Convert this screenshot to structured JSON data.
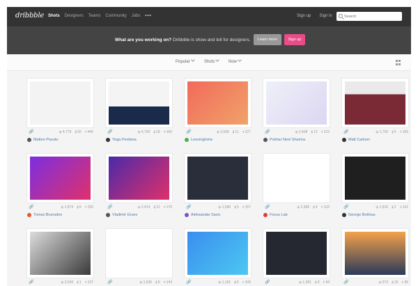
{
  "header": {
    "logo": "dribbble",
    "nav": [
      "Shots",
      "Designers",
      "Teams",
      "Community",
      "Jobs"
    ],
    "more": "•••",
    "signup": "Sign up",
    "signin": "Sign in",
    "search_placeholder": "Search"
  },
  "hero": {
    "question": "What are you working on?",
    "tagline": "Dribbble is show and tell for designers.",
    "learn_more": "Learn more",
    "sign_up": "Sign up"
  },
  "filters": {
    "popular": "Popular",
    "shots": "Shots",
    "now": "Now"
  },
  "colors": {
    "accent": "#ea4c89",
    "topbar": "#333333",
    "hero": "#444444"
  },
  "shots": [
    {
      "views": "4,779",
      "comments": "50",
      "likes": "440",
      "author": "Matteo Pasuto",
      "avatar": "#555555"
    },
    {
      "views": "4,700",
      "comments": "18",
      "likes": "390",
      "author": "Yoga Perdana",
      "avatar": "#333333"
    },
    {
      "views": "3,558",
      "comments": "11",
      "likes": "227",
      "author": "Leevinglome",
      "avatar": "#4caf50"
    },
    {
      "views": "2,408",
      "comments": "13",
      "likes": "215",
      "author": "Pokhar Neel Sharma",
      "avatar": "#555555"
    },
    {
      "views": "1,756",
      "comments": "6",
      "likes": "189",
      "author": "Matt Carlson",
      "avatar": "#333333"
    },
    {
      "views": "1,874",
      "comments": "6",
      "likes": "155",
      "author": "Tomas Brunsdon",
      "avatar": "#e8592a"
    },
    {
      "views": "2,414",
      "comments": "12",
      "likes": "170",
      "author": "Vladimir Gruev",
      "avatar": "#555555"
    },
    {
      "views": "1,586",
      "comments": "5",
      "likes": "157",
      "author": "Aleksandar Savic",
      "avatar": "#7b52c7"
    },
    {
      "views": "2,989",
      "comments": "4",
      "likes": "132",
      "author": "Focus Lab",
      "avatar": "#e03a3a"
    },
    {
      "views": "1,810",
      "comments": "2",
      "likes": "131",
      "author": "George Bokhua",
      "avatar": "#333333"
    },
    {
      "views": "2,943",
      "comments": "1",
      "likes": "137",
      "author": "",
      "avatar": "#555555"
    },
    {
      "views": "1,535",
      "comments": "6",
      "likes": "144",
      "author": "",
      "avatar": "#4caf50"
    },
    {
      "views": "1,181",
      "comments": "6",
      "likes": "109",
      "author": "",
      "avatar": "#3a7be0"
    },
    {
      "views": "1,281",
      "comments": "9",
      "likes": "94",
      "author": "",
      "avatar": "#4caf50"
    },
    {
      "views": "972",
      "comments": "16",
      "likes": "95",
      "author": "",
      "avatar": "#555555"
    }
  ]
}
